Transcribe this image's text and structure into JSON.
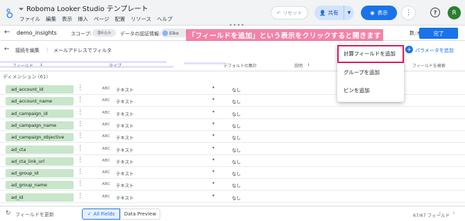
{
  "app": {
    "title": "Roboma Looker Studio テンプレート",
    "menu": [
      "ファイル",
      "編集",
      "表示",
      "挿入",
      "ページ",
      "配置",
      "リソース",
      "ヘルプ"
    ],
    "reset_label": "リセット",
    "share_label": "共有",
    "view_label": "表示",
    "avatar_letter": "R"
  },
  "datasource": {
    "name": "demo_insights",
    "scope_label": "スコープ:",
    "scope_chip": "埋め込み",
    "auth_label": "データの認証情報:",
    "auth_user": "Eiko",
    "field_count": "数:オフ",
    "done_label": "完了"
  },
  "annotation": "「フィールドを追加」という表示をクリックすると開きます",
  "toolbar": {
    "edit_connection": "接続を編集",
    "separator": "|",
    "email_filter": "メールアドレスでフィルタ",
    "add_parameter": "パラメータを追加"
  },
  "table_header": {
    "field": "フィールド",
    "type": "タイプ",
    "default_agg": "デフォルトの集計",
    "description": "説明",
    "search": "フィールドを検索"
  },
  "dimensions_title": "ディメンション (61)",
  "rows": [
    {
      "name": "ad_account_id",
      "type": "テキスト",
      "agg": "なし"
    },
    {
      "name": "ad_account_name",
      "type": "テキスト",
      "agg": "なし"
    },
    {
      "name": "ad_campaign_id",
      "type": "テキスト",
      "agg": "なし"
    },
    {
      "name": "ad_campaign_name",
      "type": "テキスト",
      "agg": "なし"
    },
    {
      "name": "ad_campaign_objective",
      "type": "テキスト",
      "agg": "なし"
    },
    {
      "name": "ad_cta",
      "type": "テキスト",
      "agg": "なし"
    },
    {
      "name": "ad_cta_link_url",
      "type": "テキスト",
      "agg": "なし"
    },
    {
      "name": "ad_group_id",
      "type": "テキスト",
      "agg": "なし"
    },
    {
      "name": "ad_group_name",
      "type": "テキスト",
      "agg": "なし"
    },
    {
      "name": "ad_id",
      "type": "テキスト",
      "agg": "なし"
    }
  ],
  "type_badge": "ABC",
  "dropdown": {
    "items": [
      "計算フィールドを追加",
      "グループを追加",
      "ビンを追加"
    ]
  },
  "bottom": {
    "refresh_label": "フィールドを更新",
    "tab_all": "All Fields",
    "tab_preview": "Data Preview",
    "count": "67/67 フィールド"
  },
  "colors": {
    "accent": "#1a73e8",
    "dimension_chip": "#c8e6c9",
    "highlight": "#d81b60"
  }
}
